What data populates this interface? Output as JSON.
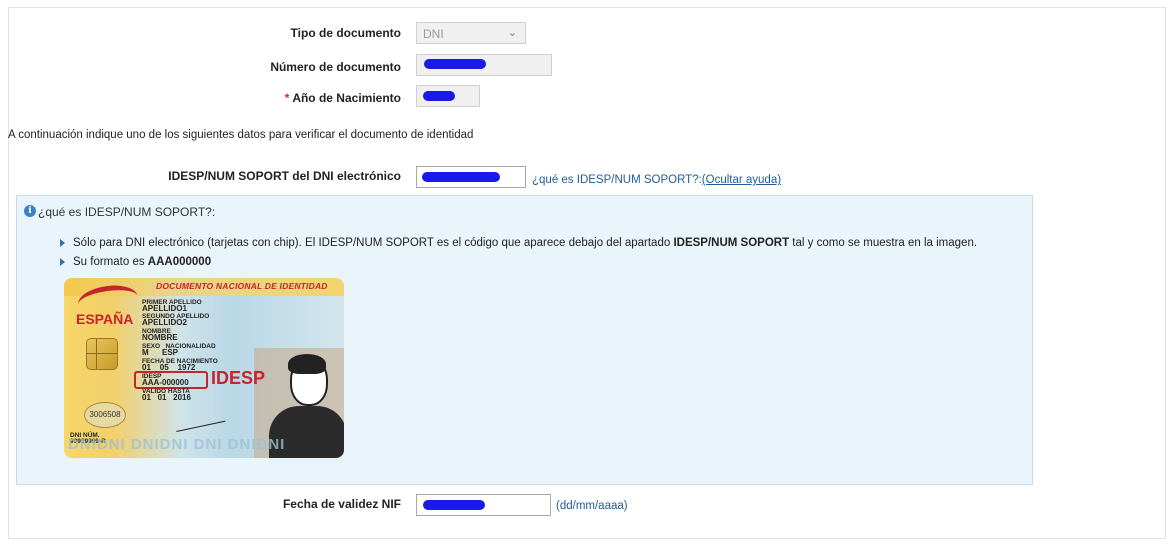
{
  "form": {
    "tipo_label": "Tipo de documento",
    "tipo_value": "DNI",
    "numero_label": "Número de documento",
    "ano_required_marker": "*",
    "ano_label": "Año de Nacimiento",
    "intro_text": "A continuación indique uno de los siguientes datos para verificar el documento de identidad",
    "idesp_label": "IDESP/NUM SOPORT del DNI electrónico",
    "idesp_help_link": "¿qué es IDESP/NUM SOPORT?:",
    "idesp_hide_link": "(Ocultar ayuda)",
    "fecha_label": "Fecha de validez NIF",
    "fecha_hint": "(dd/mm/aaaa)"
  },
  "help": {
    "title": "¿qué es IDESP/NUM SOPORT?:",
    "bullet1_pre": "Sólo para DNI electrónico (tarjetas con chip). El IDESP/NUM SOPORT es el código que aparece debajo del apartado ",
    "bullet1_bold": "IDESP/NUM SOPORT",
    "bullet1_post": " tal y como se muestra en la imagen.",
    "bullet2_pre": "Su formato es ",
    "bullet2_bold": "AAA000000"
  },
  "card": {
    "header": "DOCUMENTO NACIONAL DE IDENTIDAD",
    "country": "ESPAÑA",
    "field1": "PRIMER APELLIDO",
    "apellido1": "APELLIDO1",
    "field2": "SEGUNDO APELLIDO",
    "apellido2": "APELLIDO2",
    "field3": "NOMBRE",
    "nombre": "NOMBRE",
    "field4": "SEXO   NACIONALIDAD",
    "sexo_nac": "M      ESP",
    "field5": "FECHA DE NACIMIENTO",
    "nacimiento": "01    05    1972",
    "field6": "IDESP",
    "idesp": "AAA-000000",
    "field7": "VALIDO HASTA",
    "valido": "01   01   2016",
    "idesp_big": "IDESP",
    "seal_number": "3006508",
    "dni_num_label": "DNI NÚM.",
    "dni_num": "99999999-R",
    "watermark": "DNIDNI DNIDNI DNI DNIDNI"
  },
  "colors": {
    "redaction": "#1a1ae6",
    "link": "#1f5c99",
    "help_bg": "#eaf4fb",
    "required": "#d9222a"
  },
  "icons": {
    "info": "info-circle-icon",
    "select": "chevron-down-icon",
    "bullet": "triangle-bullet-icon"
  }
}
